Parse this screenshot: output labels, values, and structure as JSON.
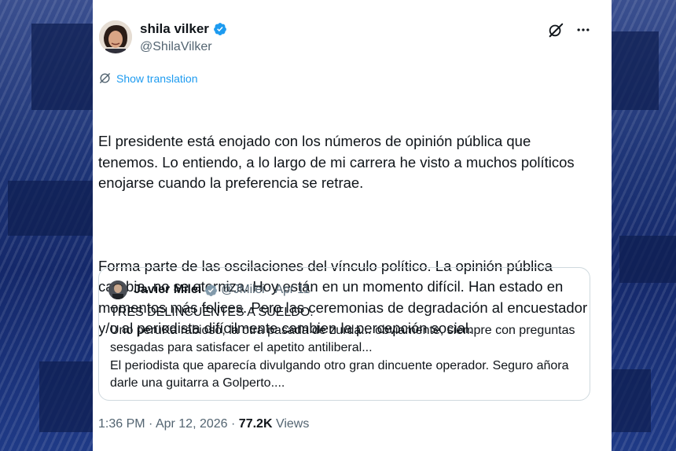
{
  "tweet": {
    "author_name": "shila vilker",
    "author_handle": "@ShilaVilker",
    "show_translation": "Show translation",
    "paragraphs": [
      "El presidente está enojado con los números de opinión pública que tenemos. Lo entiendo, a lo largo de mi carrera he visto a muchos políticos enojarse cuando la preferencia se retrae.",
      "Forma parte de las oscilaciones del vínculo político. La opinión pública cambia, no se eterniza. Hoy están en un momento difícil. Han estado en momentos más felices. Pero las ceremonias de degradación al encuestador y/o al periodista difícilmente cambien la percepción social."
    ],
    "time": "1:36 PM",
    "date": "Apr 12, 2026",
    "views_count": "77.2K",
    "views_label": "Views"
  },
  "quote": {
    "author_name": "Javier Milei",
    "author_handle": "@JMilei",
    "date": "Apr 11",
    "lines": [
      "TRES DELINCUENTES A SUELDO.",
      "Uno peruKa rabioso, la otra pasada de zurda... obviamente, siempre con preguntas sesgadas para satisfacer el apetito antiliberal...",
      "El periodista que aparecía divulgando otro gran dincuente operador. Seguro añora darle una guitarra a Golperto...."
    ]
  },
  "colors": {
    "verified": "#1d9bf0",
    "link": "#1d9bf0",
    "secondary_text": "#536471"
  },
  "icons": [
    "verified-badge-icon",
    "grok-icon",
    "more-icon",
    "translate-icon"
  ]
}
